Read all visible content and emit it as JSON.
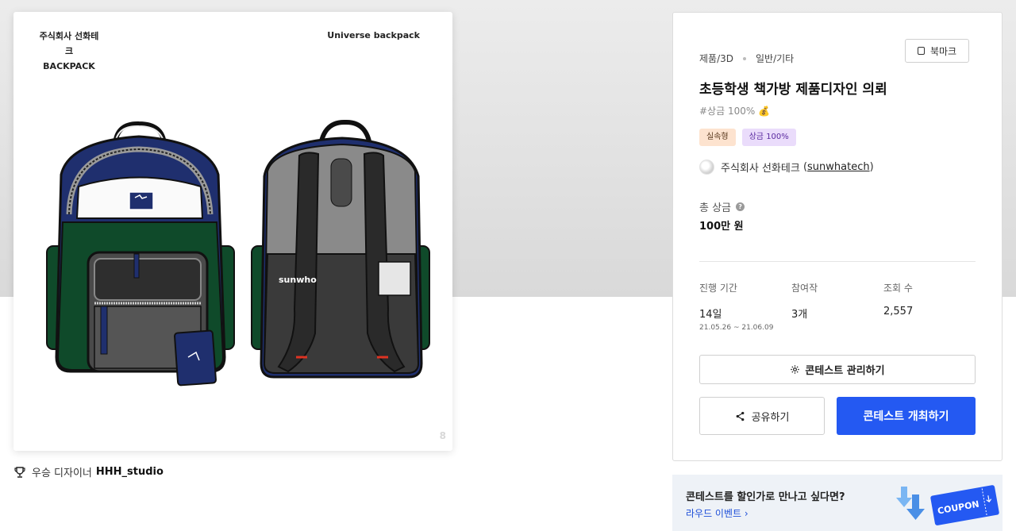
{
  "image": {
    "company_name": "주식회사 선화테크",
    "product_type": "BACKPACK",
    "product_name": "Universe backpack",
    "page_indicator": "8",
    "brand_logo_text": "sunwho"
  },
  "award": {
    "label": "우승 디자이너",
    "designer": "HHH_studio"
  },
  "contest": {
    "category": "제품/3D",
    "subcategory": "일반/기타",
    "bookmark_label": "북마크",
    "title": "초등학생 책가방 제품디자인 의뢰",
    "prize_tag": "#상금 100%",
    "badges": [
      "실속형",
      "상금 100%"
    ],
    "host_name": "주식회사 선화테크",
    "host_handle": "sunwhatech",
    "total_prize_label": "총 상금",
    "total_prize_value": "100만 원",
    "stats": [
      {
        "label": "진행 기간",
        "value": "14일",
        "sub": "21.05.26 ~ 21.06.09"
      },
      {
        "label": "참여작",
        "value": "3개",
        "sub": ""
      },
      {
        "label": "조회 수",
        "value": "2,557",
        "sub": ""
      }
    ],
    "manage_label": "콘테스트 관리하기",
    "share_label": "공유하기",
    "open_label": "콘테스트 개최하기"
  },
  "coupon_banner": {
    "text": "콘테스트를 할인가로 만나고 싶다면?",
    "link": "라우드 이벤트",
    "coupon_word": "COUPON"
  },
  "colors": {
    "primary": "#2459f2",
    "navy": "#1f2f6e",
    "green": "#0f4a2a",
    "gray": "#555555"
  }
}
